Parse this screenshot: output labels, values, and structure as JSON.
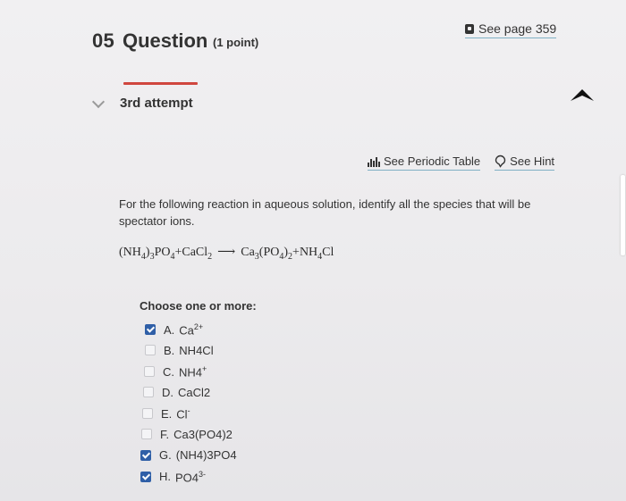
{
  "header": {
    "number": "05",
    "title": "Question",
    "points": "(1 point)",
    "see_page": "See page 359"
  },
  "attempt": {
    "label": "3rd attempt"
  },
  "tools": {
    "periodic_table": "See Periodic Table",
    "hint": "See Hint"
  },
  "question": {
    "prompt": "For the following reaction in aqueous solution, identify all the species that will be spectator ions."
  },
  "equation": {
    "r1_open": "(NH",
    "r1_sub1": "4",
    "r1_close": ")",
    "r1_sub2": "3",
    "r1_po": "PO",
    "r1_sub3": "4",
    "plus1": "+",
    "r2": "CaCl",
    "r2_sub": "2",
    "arrow": "⟶",
    "p1": "Ca",
    "p1_sub1": "3",
    "p1_open": "(PO",
    "p1_sub2": "4",
    "p1_close": ")",
    "p1_sub3": "2",
    "plus2": "+",
    "p2": "NH",
    "p2_sub": "4",
    "p2_cl": "Cl"
  },
  "choices": {
    "heading": "Choose one or more:",
    "items": [
      {
        "letter": "A.",
        "base": "Ca",
        "sup": "2+",
        "checked": true
      },
      {
        "letter": "B.",
        "text": "NH4Cl",
        "checked": false
      },
      {
        "letter": "C.",
        "base": "NH4",
        "sup": "+",
        "checked": false
      },
      {
        "letter": "D.",
        "text": "CaCl2",
        "checked": false
      },
      {
        "letter": "E.",
        "base": "Cl",
        "sup": "-",
        "checked": false
      },
      {
        "letter": "F.",
        "text": "Ca3(PO4)2",
        "checked": false
      },
      {
        "letter": "G.",
        "text": "(NH4)3PO4",
        "checked": true
      },
      {
        "letter": "H.",
        "base": "PO4",
        "sup": "3-",
        "checked": true
      }
    ]
  }
}
